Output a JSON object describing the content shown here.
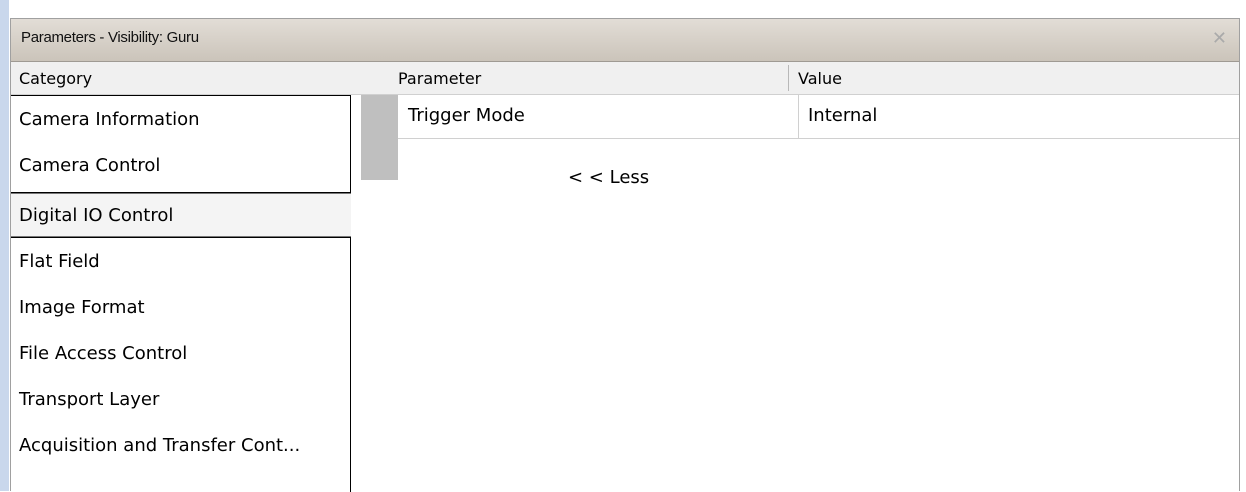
{
  "window": {
    "title": "Parameters - Visibility: Guru",
    "close_glyph": "✕"
  },
  "headers": {
    "category": "Category",
    "parameter": "Parameter",
    "value": "Value"
  },
  "categories": [
    "Camera Information",
    "Camera Control",
    "Digital IO Control",
    "Flat Field",
    "Image Format",
    "File Access Control",
    "Transport Layer",
    "Acquisition and Transfer Cont..."
  ],
  "selected_category": "Digital IO Control",
  "parameters": [
    {
      "name": "Trigger Mode",
      "value": "Internal"
    }
  ],
  "less_link": "< < Less",
  "colors": {
    "titlebar": "#cbc4ba",
    "header_bg": "#f0f0f0",
    "row_header": "#bfbfbf",
    "accent_strip": "#c9d7ec"
  }
}
